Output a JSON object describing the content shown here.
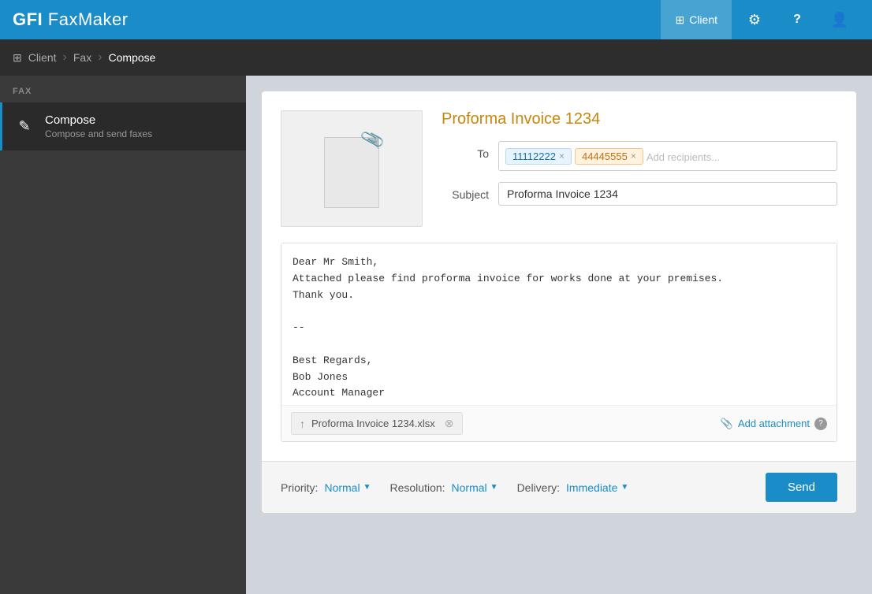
{
  "app": {
    "logo": "GFI FaxMaker",
    "logo_bold": "GFI ",
    "logo_light": "FaxMaker"
  },
  "topnav": {
    "client_label": "Client",
    "settings_label": "⚙",
    "help_label": "?",
    "user_label": "👤"
  },
  "breadcrumb": {
    "client": "Client",
    "fax": "Fax",
    "compose": "Compose"
  },
  "sidebar": {
    "section_label": "FAX",
    "items": [
      {
        "id": "compose",
        "label": "Compose",
        "sublabel": "Compose and send faxes",
        "active": true
      }
    ]
  },
  "compose": {
    "title": "Proforma Invoice 1234",
    "to_label": "To",
    "recipients": [
      {
        "number": "11112222",
        "style": "blue"
      },
      {
        "number": "44445555",
        "style": "orange"
      }
    ],
    "recipients_placeholder": "Add recipients...",
    "subject_label": "Subject",
    "subject_value": "Proforma Invoice 1234",
    "message_body": "Dear Mr Smith,\nAttached please find proforma invoice for works done at your premises.\nThank you.\n\n--\n\nBest Regards,\nBob Jones\nAccount Manager",
    "attachment_filename": "Proforma Invoice 1234.xlsx",
    "add_attachment_label": "Add attachment",
    "footer": {
      "priority_label": "Priority:",
      "priority_value": "Normal",
      "resolution_label": "Resolution:",
      "resolution_value": "Normal",
      "delivery_label": "Delivery:",
      "delivery_value": "Immediate",
      "send_label": "Send"
    }
  }
}
